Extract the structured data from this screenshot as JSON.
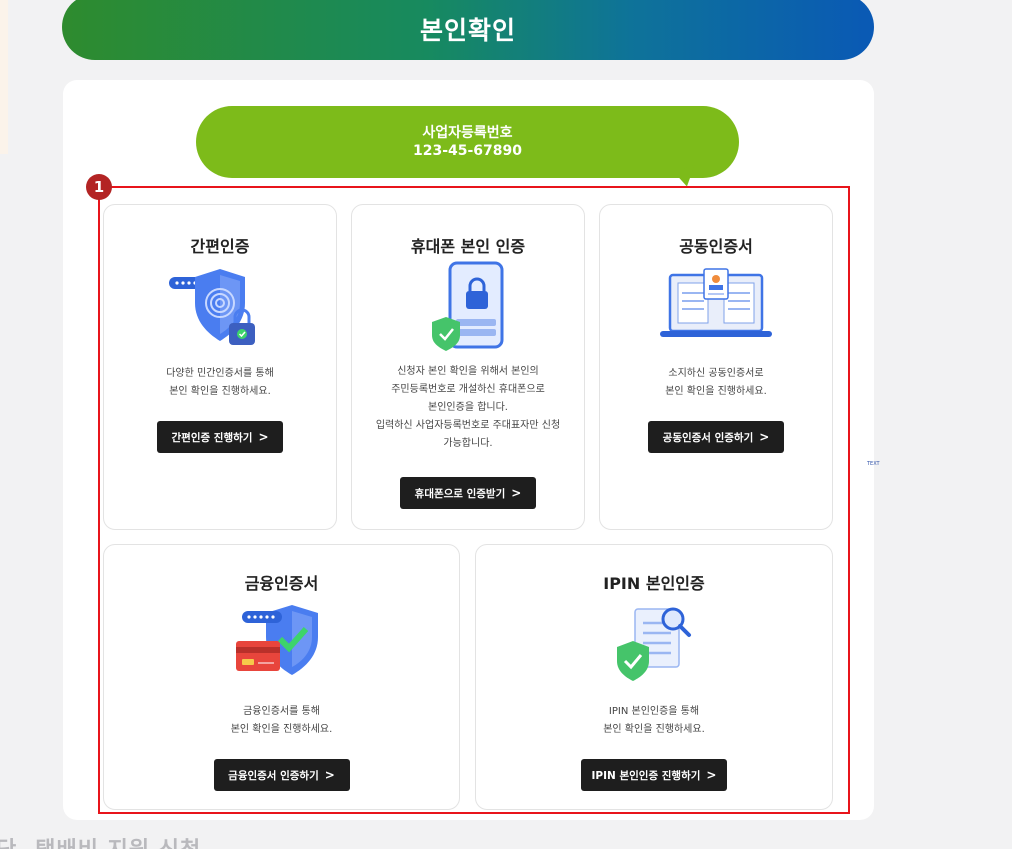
{
  "header": {
    "title": "본인확인"
  },
  "business_number": {
    "label": "사업자등록번호",
    "value": "123-45-67890"
  },
  "marker": "1",
  "methods": [
    {
      "title": "간편인증",
      "icon": "shield-fingerprint-lock-icon",
      "desc": [
        "다양한 민간인증서를 통해",
        "본인 확인을 진행하세요."
      ],
      "button": "간편인증 진행하기",
      "chevron": ">"
    },
    {
      "title": "휴대폰 본인 인증",
      "icon": "phone-lock-shield-icon",
      "desc": [
        "신청자 본인 확인을 위해서 본인의",
        "주민등록번호로 개설하신 휴대폰으로",
        "본인인증을 합니다.",
        "입력하신 사업자등록번호로 주대표자만 신청",
        "가능합니다."
      ],
      "button": "휴대폰으로 인증받기",
      "chevron": ">"
    },
    {
      "title": "공동인증서",
      "icon": "laptop-certificate-icon",
      "desc": [
        "소지하신 공동인증서로",
        "본인 확인을 진행하세요."
      ],
      "button": "공동인증서 인증하기",
      "chevron": ">"
    },
    {
      "title": "금융인증서",
      "icon": "shield-card-check-icon",
      "desc": [
        "금융인증서를 통해",
        "본인 확인을 진행하세요."
      ],
      "button": "금융인증서 인증하기",
      "chevron": ">"
    },
    {
      "title": "IPIN 본인인증",
      "icon": "document-magnifier-shield-icon",
      "desc": [
        "IPIN 본인인증을 통해",
        "본인 확인을 진행하세요."
      ],
      "button": "IPIN 본인인증 진행하기",
      "chevron": ">"
    }
  ],
  "tiny_label": "TEXT",
  "bottom_text": "단. 택배비 지원 신청",
  "colors": {
    "header_gradient_start": "#2e8b2e",
    "header_gradient_end": "#0a59b5",
    "bubble_green": "#7dbb1a",
    "highlight_red": "#e8141b",
    "button_dark": "#1e1e1e"
  }
}
